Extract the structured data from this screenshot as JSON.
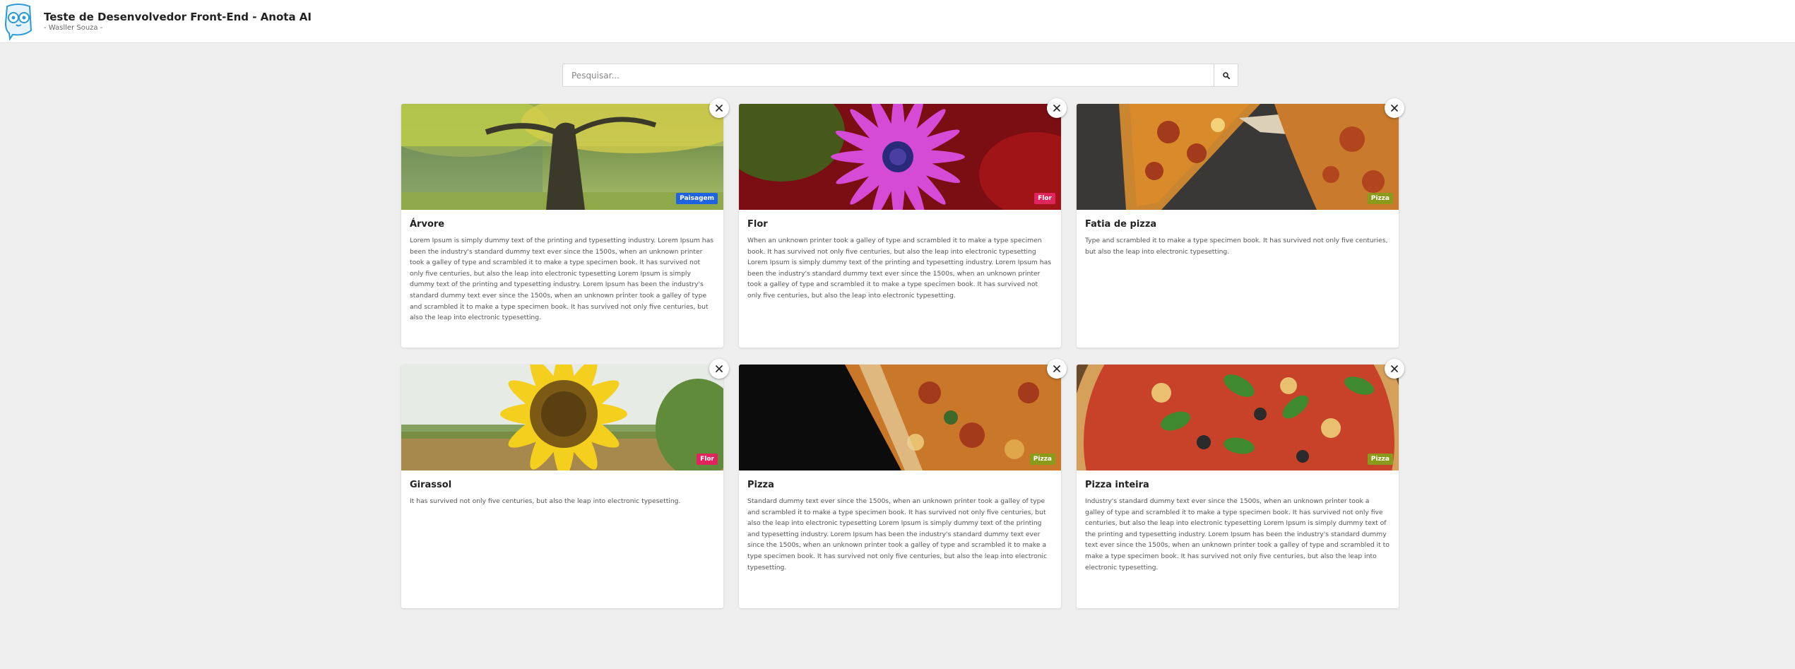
{
  "header": {
    "title": "Teste de Desenvolvedor Front-End - Anota AI",
    "subtitle": "- Wasller Souza -",
    "logo_icon": "owl-logo-icon"
  },
  "search": {
    "placeholder": "Pesquisar...",
    "value": "",
    "button_icon": "search-icon"
  },
  "cards": [
    {
      "title": "Árvore",
      "tag": "Paisagem",
      "tag_color": "#1f63e0",
      "image": "tree-in-park",
      "description": "Lorem Ipsum is simply dummy text of the printing and typesetting industry. Lorem Ipsum has been the industry's standard dummy text ever since the 1500s, when an unknown printer took a galley of type and scrambled it to make a type specimen book. It has survived not only five centuries, but also the leap into electronic typesetting Lorem Ipsum is simply dummy text of the printing and typesetting industry. Lorem Ipsum has been the industry's standard dummy text ever since the 1500s, when an unknown printer took a galley of type and scrambled it to make a type specimen book. It has survived not only five centuries, but also the leap into electronic typesetting."
    },
    {
      "title": "Flor",
      "tag": "Flor",
      "tag_color": "#e0245e",
      "image": "pink-daisy",
      "description": "When an unknown printer took a galley of type and scrambled it to make a type specimen book. It has survived not only five centuries, but also the leap into electronic typesetting Lorem Ipsum is simply dummy text of the printing and typesetting industry. Lorem Ipsum has been the industry's standard dummy text ever since the 1500s, when an unknown printer took a galley of type and scrambled it to make a type specimen book. It has survived not only five centuries, but also the leap into electronic typesetting."
    },
    {
      "title": "Fatia de pizza",
      "tag": "Pizza",
      "tag_color": "#8a9a1a",
      "image": "pizza-slice",
      "description": "Type and scrambled it to make a type specimen book. It has survived not only five centuries, but also the leap into electronic typesetting."
    },
    {
      "title": "Girassol",
      "tag": "Flor",
      "tag_color": "#e0245e",
      "image": "sunflower",
      "description": "It has survived not only five centuries, but also the leap into electronic typesetting."
    },
    {
      "title": "Pizza",
      "tag": "Pizza",
      "tag_color": "#8a9a1a",
      "image": "pizza-dark",
      "description": "Standard dummy text ever since the 1500s, when an unknown printer took a galley of type and scrambled it to make a type specimen book. It has survived not only five centuries, but also the leap into electronic typesetting Lorem Ipsum is simply dummy text of the printing and typesetting industry. Lorem Ipsum has been the industry's standard dummy text ever since the 1500s, when an unknown printer took a galley of type and scrambled it to make a type specimen book. It has survived not only five centuries, but also the leap into electronic typesetting."
    },
    {
      "title": "Pizza inteira",
      "tag": "Pizza",
      "tag_color": "#8a9a1a",
      "image": "whole-pizza",
      "description": "Industry's standard dummy text ever since the 1500s, when an unknown printer took a galley of type and scrambled it to make a type specimen book. It has survived not only five centuries, but also the leap into electronic typesetting Lorem Ipsum is simply dummy text of the printing and typesetting industry. Lorem Ipsum has been the industry's standard dummy text ever since the 1500s, when an unknown printer took a galley of type and scrambled it to make a type specimen book. It has survived not only five centuries, but also the leap into electronic typesetting."
    }
  ],
  "card_close_icon": "close-icon"
}
